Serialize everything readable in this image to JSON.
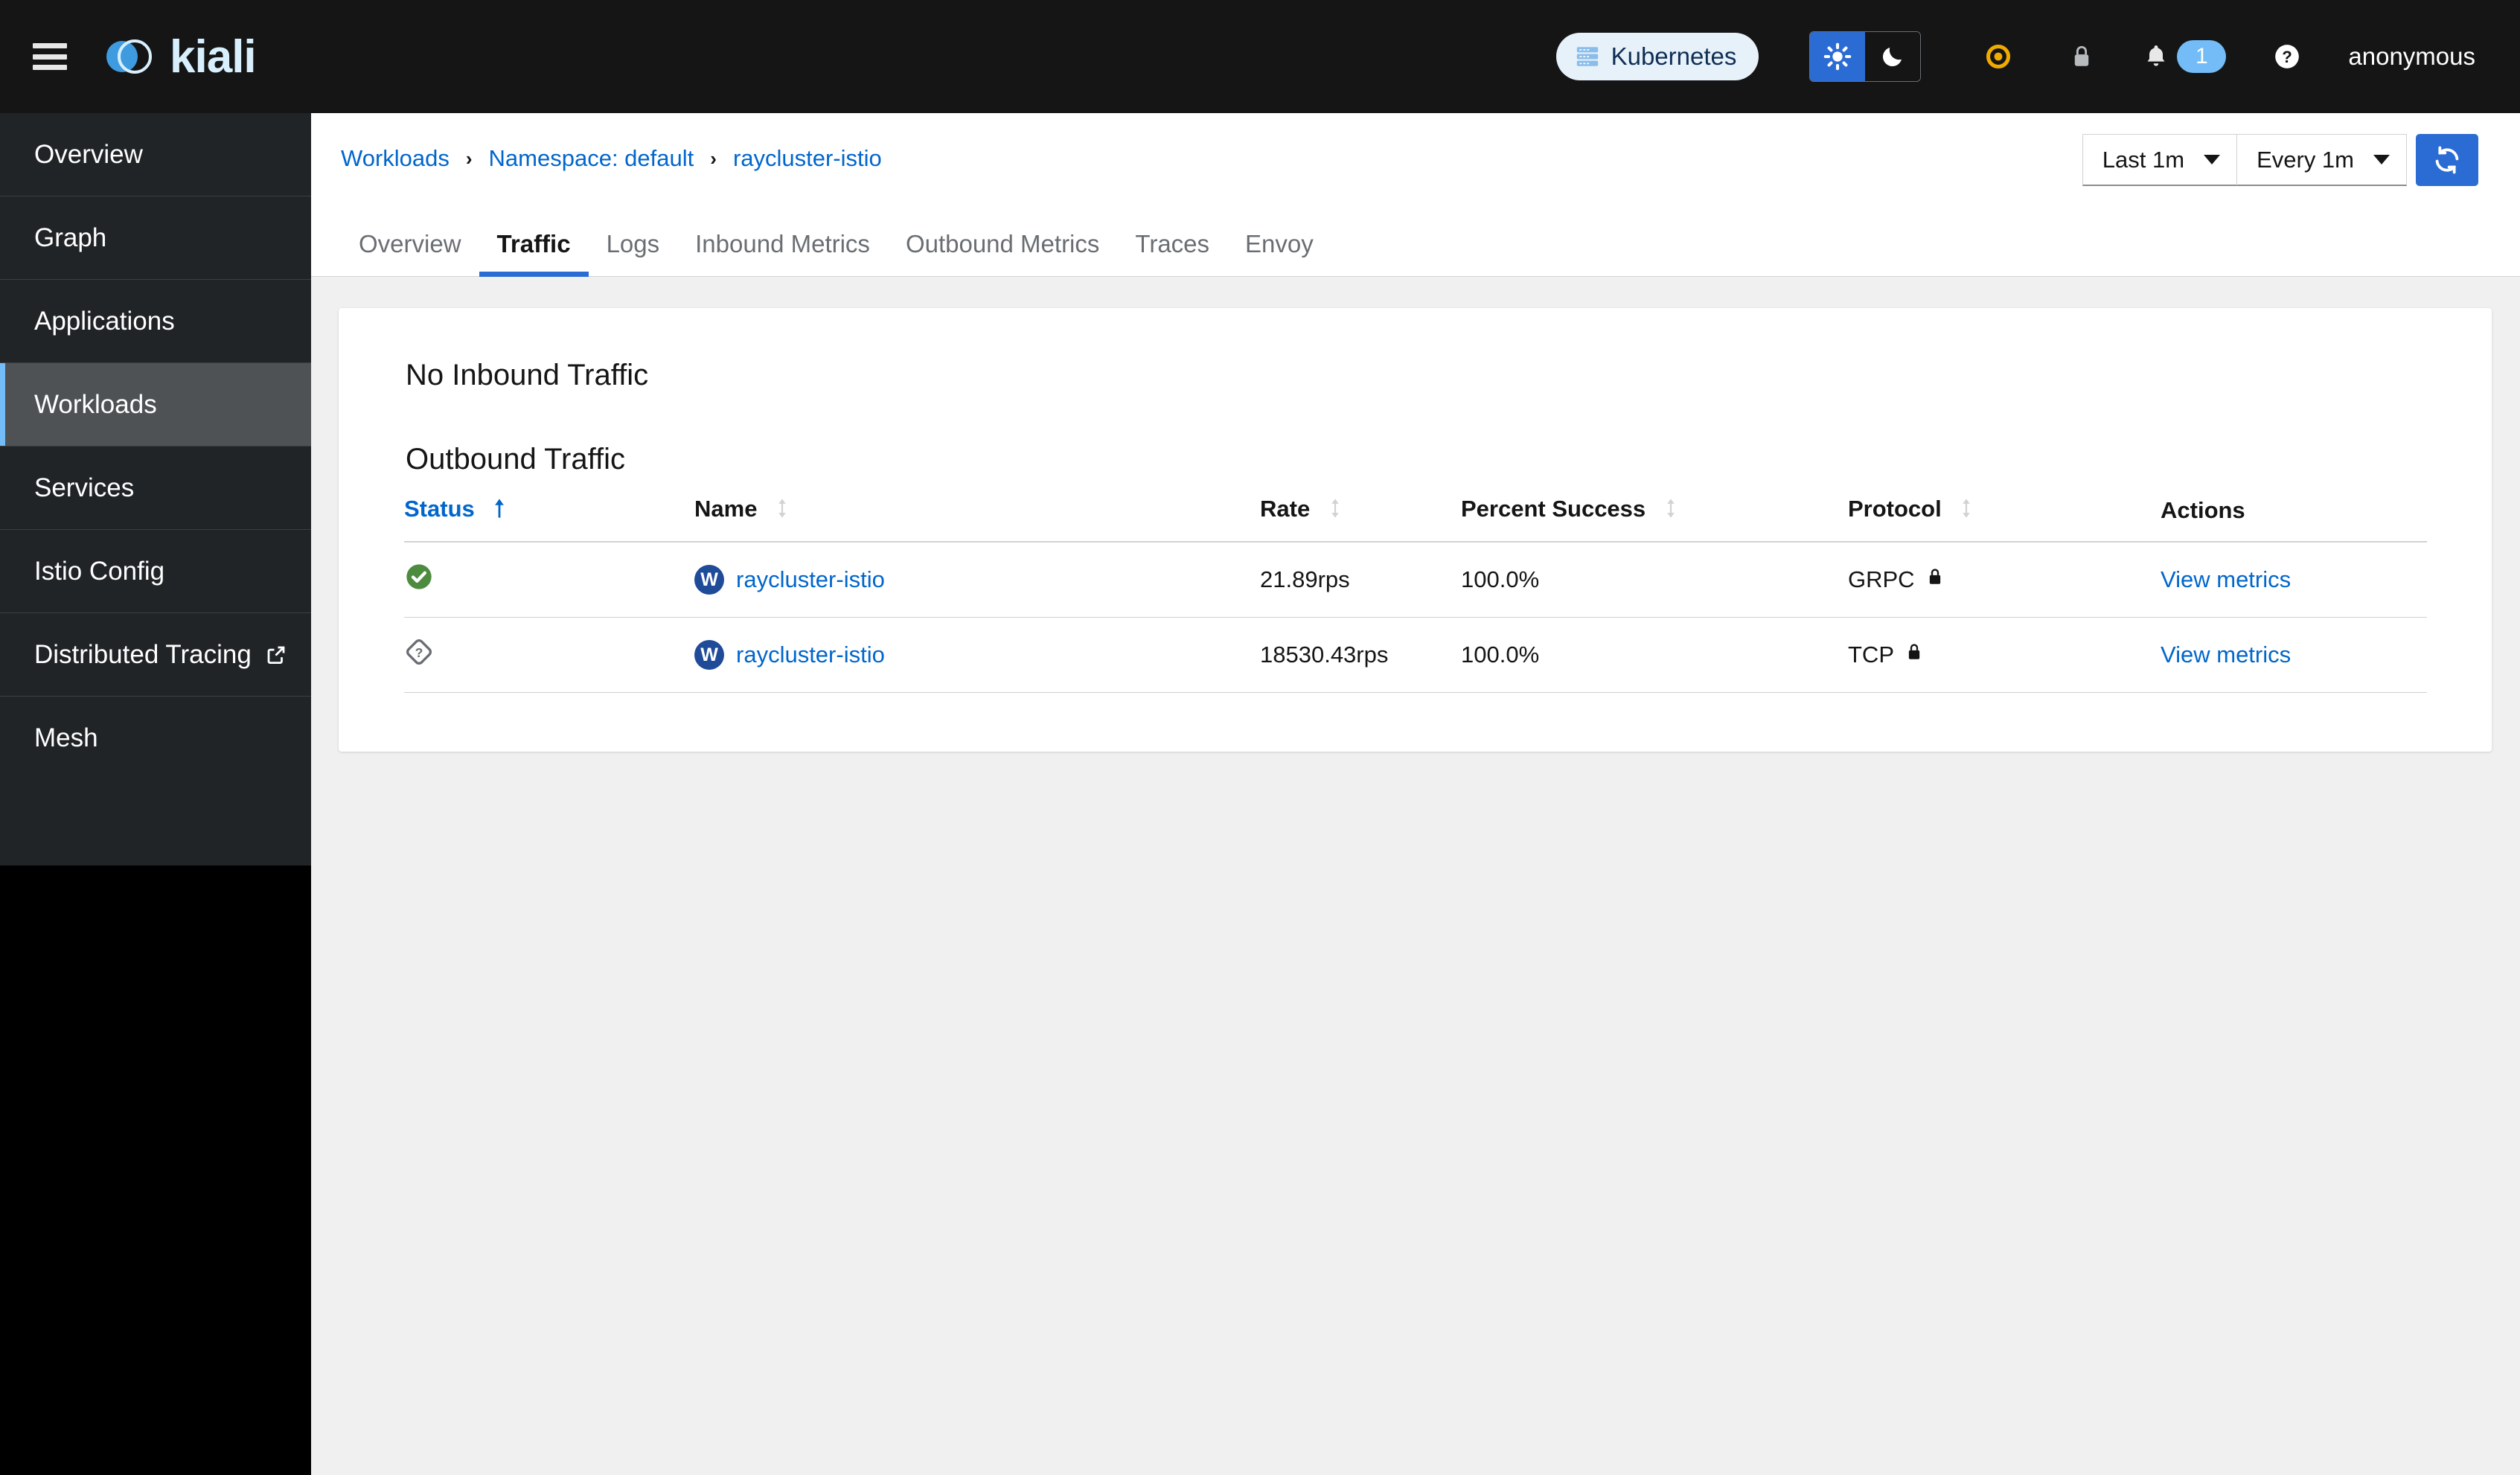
{
  "masthead": {
    "menu_icon": "hamburger-icon",
    "brand": "kiali",
    "cluster_pill": {
      "label": "Kubernetes",
      "icon": "cluster-icon",
      "bg": "#e7f1fa",
      "fg": "#0f2e54"
    },
    "theme": {
      "light_icon": "sun-icon",
      "dark_icon": "moon-icon",
      "active": "light",
      "active_bg": "#2b6cd4"
    },
    "icons": [
      {
        "name": "istio-status-icon",
        "color": "#f0ab00"
      },
      {
        "name": "lock-icon",
        "color": "#b8bbbe"
      },
      {
        "name": "help-icon",
        "color": "#ffffff"
      }
    ],
    "notifications": {
      "icon": "bell-icon",
      "count": "1",
      "badge_color": "#73bcf7"
    },
    "user": "anonymous"
  },
  "sidebar": {
    "items": [
      {
        "label": "Overview",
        "active": false,
        "external": false
      },
      {
        "label": "Graph",
        "active": false,
        "external": false
      },
      {
        "label": "Applications",
        "active": false,
        "external": false
      },
      {
        "label": "Workloads",
        "active": true,
        "external": false
      },
      {
        "label": "Services",
        "active": false,
        "external": false
      },
      {
        "label": "Istio Config",
        "active": false,
        "external": false
      },
      {
        "label": "Distributed Tracing",
        "active": false,
        "external": true
      },
      {
        "label": "Mesh",
        "active": false,
        "external": false
      }
    ],
    "active_accent": "#73bcf7"
  },
  "breadcrumb": {
    "items": [
      "Workloads",
      "Namespace: default",
      "raycluster-istio"
    ],
    "separator": "›"
  },
  "time_controls": {
    "range": "Last 1m",
    "refresh_interval": "Every 1m",
    "refresh_button_icon": "refresh-icon",
    "refresh_button_color": "#2b6cd4"
  },
  "tabs": [
    {
      "label": "Overview",
      "active": false
    },
    {
      "label": "Traffic",
      "active": true
    },
    {
      "label": "Logs",
      "active": false
    },
    {
      "label": "Inbound Metrics",
      "active": false
    },
    {
      "label": "Outbound Metrics",
      "active": false
    },
    {
      "label": "Traces",
      "active": false
    },
    {
      "label": "Envoy",
      "active": false
    }
  ],
  "content": {
    "inbound_heading": "No Inbound Traffic",
    "outbound_heading": "Outbound Traffic",
    "columns": [
      {
        "label": "Status",
        "sort": "asc",
        "active": true
      },
      {
        "label": "Name",
        "sort": "none",
        "active": false
      },
      {
        "label": "Rate",
        "sort": "none",
        "active": false
      },
      {
        "label": "Percent Success",
        "sort": "none",
        "active": false
      },
      {
        "label": "Protocol",
        "sort": "none",
        "active": false
      },
      {
        "label": "Actions",
        "sort": null,
        "active": false
      }
    ],
    "rows": [
      {
        "status_icon": "check-circle-icon",
        "status_color": "#4d8b3f",
        "badge": "W",
        "name": "raycluster-istio",
        "rate": "21.89rps",
        "percent_success": "100.0%",
        "protocol": "GRPC",
        "protocol_icon": "lock-icon",
        "action": "View metrics"
      },
      {
        "status_icon": "unknown-diamond-icon",
        "status_color": "#6a6e73",
        "badge": "W",
        "name": "raycluster-istio",
        "rate": "18530.43rps",
        "percent_success": "100.0%",
        "protocol": "TCP",
        "protocol_icon": "lock-icon",
        "action": "View metrics"
      }
    ]
  }
}
